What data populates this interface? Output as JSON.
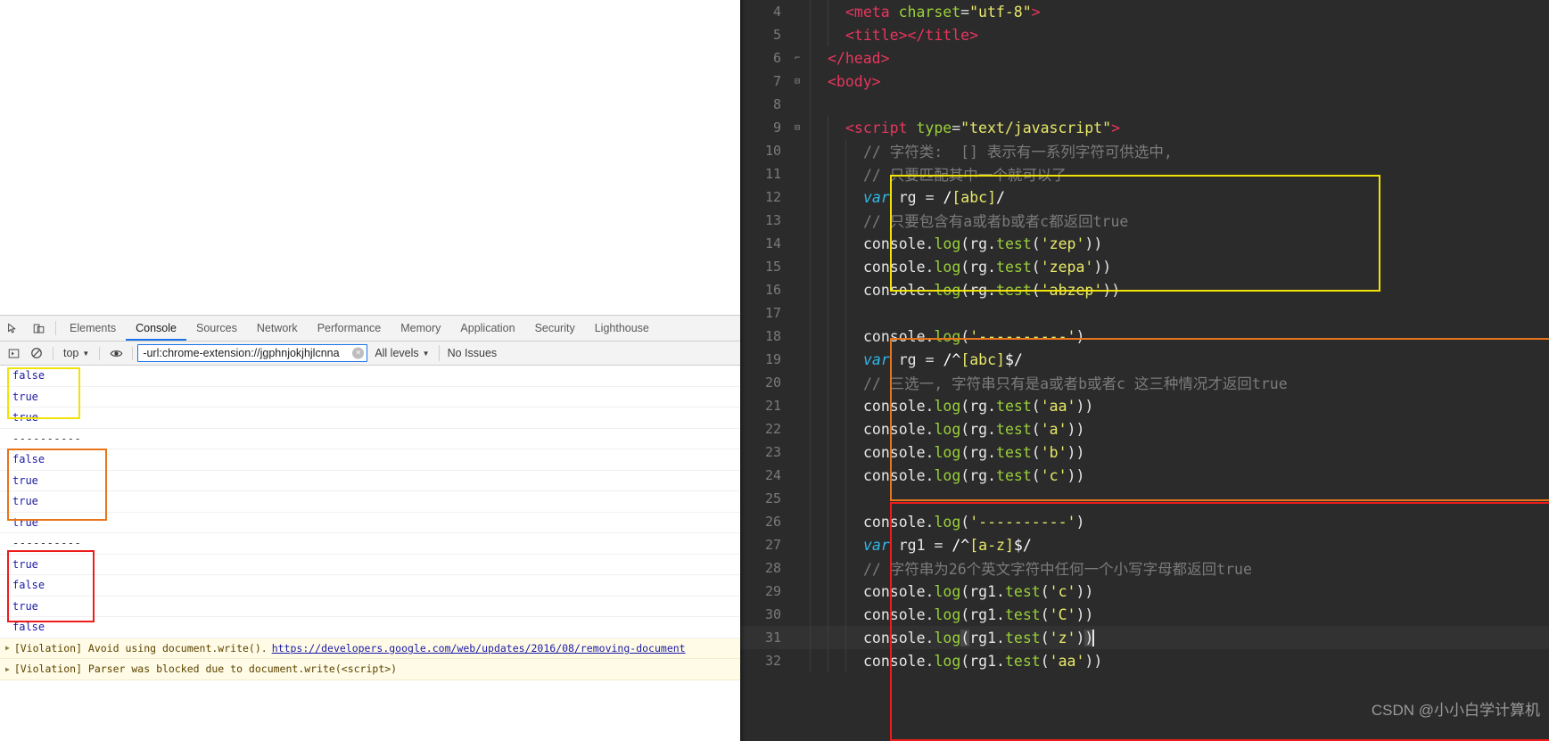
{
  "devtools": {
    "icons": {
      "inspect": "inspect-element-icon",
      "device": "device-toolbar-icon"
    },
    "tabs": [
      {
        "label": "Elements",
        "active": false
      },
      {
        "label": "Console",
        "active": true
      },
      {
        "label": "Sources",
        "active": false
      },
      {
        "label": "Network",
        "active": false
      },
      {
        "label": "Performance",
        "active": false
      },
      {
        "label": "Memory",
        "active": false
      },
      {
        "label": "Application",
        "active": false
      },
      {
        "label": "Security",
        "active": false
      },
      {
        "label": "Lighthouse",
        "active": false
      }
    ],
    "filterbar": {
      "execute_label": "▶",
      "clear_label": "⊘",
      "context": "top",
      "eye_label": "◉",
      "filter_value": "-url:chrome-extension://jgphnjokjhjlcnna",
      "filter_placeholder": "Filter",
      "clear_filter_label": "×",
      "levels": "All levels",
      "issues": "No Issues"
    },
    "messages": [
      {
        "text": "false",
        "type": "value"
      },
      {
        "text": "true",
        "type": "value"
      },
      {
        "text": "true",
        "type": "value"
      },
      {
        "text": "----------",
        "type": "dash"
      },
      {
        "text": "false",
        "type": "value"
      },
      {
        "text": "true",
        "type": "value"
      },
      {
        "text": "true",
        "type": "value"
      },
      {
        "text": "true",
        "type": "value"
      },
      {
        "text": "----------",
        "type": "dash"
      },
      {
        "text": "true",
        "type": "value"
      },
      {
        "text": "false",
        "type": "value"
      },
      {
        "text": "true",
        "type": "value"
      },
      {
        "text": "false",
        "type": "value"
      }
    ],
    "violations": [
      {
        "prefix": "[Violation] Avoid using document.write().",
        "link": "https://developers.google.com/web/updates/2016/08/removing-document"
      },
      {
        "prefix": "[Violation] Parser was blocked due to document.write(<script>)",
        "link": ""
      }
    ],
    "highlight_colors": {
      "yellow": "#f2e205",
      "orange": "#e8741b",
      "red": "#ee1c1c"
    }
  },
  "editor": {
    "first_line_number": 4,
    "current_line": 31,
    "lines": [
      {
        "n": 4,
        "fold": "",
        "indent": 2,
        "tokens": [
          {
            "t": "tag",
            "v": "<meta"
          },
          {
            "t": "txt",
            "v": " "
          },
          {
            "t": "attr",
            "v": "charset"
          },
          {
            "t": "op",
            "v": "="
          },
          {
            "t": "str",
            "v": "\"utf-8\""
          },
          {
            "t": "tag",
            "v": ">"
          }
        ]
      },
      {
        "n": 5,
        "fold": "",
        "indent": 2,
        "tokens": [
          {
            "t": "tag",
            "v": "<title></title>"
          }
        ]
      },
      {
        "n": 6,
        "fold": "-",
        "indent": 1,
        "tokens": [
          {
            "t": "tag",
            "v": "</head>"
          }
        ]
      },
      {
        "n": 7,
        "fold": "+",
        "indent": 1,
        "tokens": [
          {
            "t": "tag",
            "v": "<body>"
          }
        ]
      },
      {
        "n": 8,
        "fold": "",
        "indent": 1,
        "tokens": []
      },
      {
        "n": 9,
        "fold": "+",
        "indent": 2,
        "tokens": [
          {
            "t": "tag",
            "v": "<script"
          },
          {
            "t": "txt",
            "v": " "
          },
          {
            "t": "attr",
            "v": "type"
          },
          {
            "t": "op",
            "v": "="
          },
          {
            "t": "str",
            "v": "\"text/javascript\""
          },
          {
            "t": "tag",
            "v": ">"
          }
        ]
      },
      {
        "n": 10,
        "fold": "",
        "indent": 3,
        "tokens": [
          {
            "t": "cmt",
            "v": "// 字符类:  [] 表示有一系列字符可供选中,"
          }
        ]
      },
      {
        "n": 11,
        "fold": "",
        "indent": 3,
        "tokens": [
          {
            "t": "cmt",
            "v": "// 只要匹配其中一个就可以了"
          }
        ]
      },
      {
        "n": 12,
        "fold": "",
        "indent": 3,
        "tokens": [
          {
            "t": "kw",
            "v": "var"
          },
          {
            "t": "txt",
            "v": " rg "
          },
          {
            "t": "op",
            "v": "="
          },
          {
            "t": "txt",
            "v": " "
          },
          {
            "t": "re2",
            "v": "/"
          },
          {
            "t": "re",
            "v": "[abc]"
          },
          {
            "t": "re2",
            "v": "/"
          }
        ]
      },
      {
        "n": 13,
        "fold": "",
        "indent": 3,
        "tokens": [
          {
            "t": "cmt",
            "v": "// 只要包含有a或者b或者c都返回true"
          }
        ]
      },
      {
        "n": 14,
        "fold": "",
        "indent": 3,
        "tokens": [
          {
            "t": "txt",
            "v": "console."
          },
          {
            "t": "fn",
            "v": "log"
          },
          {
            "t": "txt",
            "v": "(rg."
          },
          {
            "t": "fn",
            "v": "test"
          },
          {
            "t": "txt",
            "v": "("
          },
          {
            "t": "str",
            "v": "'zep'"
          },
          {
            "t": "txt",
            "v": "))"
          }
        ]
      },
      {
        "n": 15,
        "fold": "",
        "indent": 3,
        "tokens": [
          {
            "t": "txt",
            "v": "console."
          },
          {
            "t": "fn",
            "v": "log"
          },
          {
            "t": "txt",
            "v": "(rg."
          },
          {
            "t": "fn",
            "v": "test"
          },
          {
            "t": "txt",
            "v": "("
          },
          {
            "t": "str",
            "v": "'zepa'"
          },
          {
            "t": "txt",
            "v": "))"
          }
        ]
      },
      {
        "n": 16,
        "fold": "",
        "indent": 3,
        "tokens": [
          {
            "t": "txt",
            "v": "console."
          },
          {
            "t": "fn",
            "v": "log"
          },
          {
            "t": "txt",
            "v": "(rg."
          },
          {
            "t": "fn",
            "v": "test"
          },
          {
            "t": "txt",
            "v": "("
          },
          {
            "t": "str",
            "v": "'abzep'"
          },
          {
            "t": "txt",
            "v": "))"
          }
        ]
      },
      {
        "n": 17,
        "fold": "",
        "indent": 3,
        "tokens": []
      },
      {
        "n": 18,
        "fold": "",
        "indent": 3,
        "tokens": [
          {
            "t": "txt",
            "v": "console."
          },
          {
            "t": "fn",
            "v": "log"
          },
          {
            "t": "txt",
            "v": "("
          },
          {
            "t": "str",
            "v": "'----------'"
          },
          {
            "t": "txt",
            "v": ")"
          }
        ]
      },
      {
        "n": 19,
        "fold": "",
        "indent": 3,
        "tokens": [
          {
            "t": "kw",
            "v": "var"
          },
          {
            "t": "txt",
            "v": " rg "
          },
          {
            "t": "op",
            "v": "="
          },
          {
            "t": "txt",
            "v": " "
          },
          {
            "t": "re2",
            "v": "/^"
          },
          {
            "t": "re",
            "v": "[abc]"
          },
          {
            "t": "re2",
            "v": "$/"
          }
        ]
      },
      {
        "n": 20,
        "fold": "",
        "indent": 3,
        "tokens": [
          {
            "t": "cmt",
            "v": "// 三选一, 字符串只有是a或者b或者c 这三种情况才返回true"
          }
        ]
      },
      {
        "n": 21,
        "fold": "",
        "indent": 3,
        "tokens": [
          {
            "t": "txt",
            "v": "console."
          },
          {
            "t": "fn",
            "v": "log"
          },
          {
            "t": "txt",
            "v": "(rg."
          },
          {
            "t": "fn",
            "v": "test"
          },
          {
            "t": "txt",
            "v": "("
          },
          {
            "t": "str",
            "v": "'aa'"
          },
          {
            "t": "txt",
            "v": "))"
          }
        ]
      },
      {
        "n": 22,
        "fold": "",
        "indent": 3,
        "tokens": [
          {
            "t": "txt",
            "v": "console."
          },
          {
            "t": "fn",
            "v": "log"
          },
          {
            "t": "txt",
            "v": "(rg."
          },
          {
            "t": "fn",
            "v": "test"
          },
          {
            "t": "txt",
            "v": "("
          },
          {
            "t": "str",
            "v": "'a'"
          },
          {
            "t": "txt",
            "v": "))"
          }
        ]
      },
      {
        "n": 23,
        "fold": "",
        "indent": 3,
        "tokens": [
          {
            "t": "txt",
            "v": "console."
          },
          {
            "t": "fn",
            "v": "log"
          },
          {
            "t": "txt",
            "v": "(rg."
          },
          {
            "t": "fn",
            "v": "test"
          },
          {
            "t": "txt",
            "v": "("
          },
          {
            "t": "str",
            "v": "'b'"
          },
          {
            "t": "txt",
            "v": "))"
          }
        ]
      },
      {
        "n": 24,
        "fold": "",
        "indent": 3,
        "tokens": [
          {
            "t": "txt",
            "v": "console."
          },
          {
            "t": "fn",
            "v": "log"
          },
          {
            "t": "txt",
            "v": "(rg."
          },
          {
            "t": "fn",
            "v": "test"
          },
          {
            "t": "txt",
            "v": "("
          },
          {
            "t": "str",
            "v": "'c'"
          },
          {
            "t": "txt",
            "v": "))"
          }
        ]
      },
      {
        "n": 25,
        "fold": "",
        "indent": 3,
        "tokens": []
      },
      {
        "n": 26,
        "fold": "",
        "indent": 3,
        "tokens": [
          {
            "t": "txt",
            "v": "console."
          },
          {
            "t": "fn",
            "v": "log"
          },
          {
            "t": "txt",
            "v": "("
          },
          {
            "t": "str",
            "v": "'----------'"
          },
          {
            "t": "txt",
            "v": ")"
          }
        ]
      },
      {
        "n": 27,
        "fold": "",
        "indent": 3,
        "tokens": [
          {
            "t": "kw",
            "v": "var"
          },
          {
            "t": "txt",
            "v": " rg1 "
          },
          {
            "t": "op",
            "v": "="
          },
          {
            "t": "txt",
            "v": " "
          },
          {
            "t": "re2",
            "v": "/^"
          },
          {
            "t": "re",
            "v": "[a-z]"
          },
          {
            "t": "re2",
            "v": "$/"
          }
        ]
      },
      {
        "n": 28,
        "fold": "",
        "indent": 3,
        "tokens": [
          {
            "t": "cmt",
            "v": "// 字符串为26个英文字符中任何一个小写字母都返回true"
          }
        ]
      },
      {
        "n": 29,
        "fold": "",
        "indent": 3,
        "tokens": [
          {
            "t": "txt",
            "v": "console."
          },
          {
            "t": "fn",
            "v": "log"
          },
          {
            "t": "txt",
            "v": "(rg1."
          },
          {
            "t": "fn",
            "v": "test"
          },
          {
            "t": "txt",
            "v": "("
          },
          {
            "t": "str",
            "v": "'c'"
          },
          {
            "t": "txt",
            "v": "))"
          }
        ]
      },
      {
        "n": 30,
        "fold": "",
        "indent": 3,
        "tokens": [
          {
            "t": "txt",
            "v": "console."
          },
          {
            "t": "fn",
            "v": "log"
          },
          {
            "t": "txt",
            "v": "(rg1."
          },
          {
            "t": "fn",
            "v": "test"
          },
          {
            "t": "txt",
            "v": "("
          },
          {
            "t": "str",
            "v": "'C'"
          },
          {
            "t": "txt",
            "v": "))"
          }
        ]
      },
      {
        "n": 31,
        "fold": "",
        "indent": 3,
        "tokens": [
          {
            "t": "txt",
            "v": "console."
          },
          {
            "t": "fn",
            "v": "log"
          },
          {
            "t": "sel",
            "v": "("
          },
          {
            "t": "txt",
            "v": "rg1."
          },
          {
            "t": "fn",
            "v": "test"
          },
          {
            "t": "txt",
            "v": "("
          },
          {
            "t": "str",
            "v": "'z'"
          },
          {
            "t": "txt",
            "v": ")"
          },
          {
            "t": "sel",
            "v": ")"
          },
          {
            "t": "caret",
            "v": ""
          }
        ]
      },
      {
        "n": 32,
        "fold": "",
        "indent": 3,
        "tokens": [
          {
            "t": "txt",
            "v": "console."
          },
          {
            "t": "fn",
            "v": "log"
          },
          {
            "t": "txt",
            "v": "(rg1."
          },
          {
            "t": "fn",
            "v": "test"
          },
          {
            "t": "txt",
            "v": "("
          },
          {
            "t": "str",
            "v": "'aa'"
          },
          {
            "t": "txt",
            "v": "))"
          }
        ]
      }
    ]
  },
  "watermark": "CSDN @小小白学计算机"
}
